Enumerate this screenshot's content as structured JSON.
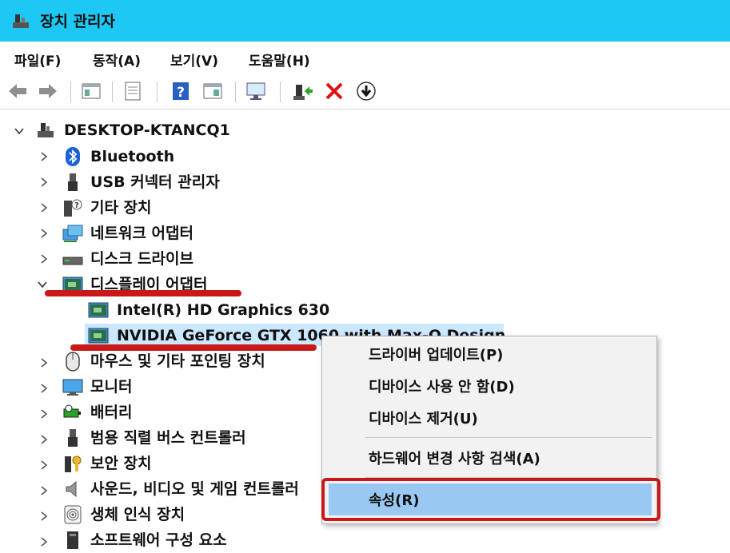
{
  "window": {
    "title": "장치 관리자"
  },
  "menu": [
    "파일(F)",
    "동작(A)",
    "보기(V)",
    "도움말(H)"
  ],
  "tree": {
    "root": "DESKTOP-KTANCQ1",
    "items": [
      {
        "label": "Bluetooth",
        "icon": "bluetooth-icon"
      },
      {
        "label": "USB 커넥터 관리자",
        "icon": "usb-icon"
      },
      {
        "label": "기타 장치",
        "icon": "unknown-device-icon"
      },
      {
        "label": "네트워크 어댑터",
        "icon": "network-icon"
      },
      {
        "label": "디스크 드라이브",
        "icon": "disk-icon"
      },
      {
        "label": "디스플레이 어댑터",
        "icon": "display-adapter-icon"
      },
      {
        "label": "Intel(R) HD Graphics 630",
        "icon": "display-adapter-icon"
      },
      {
        "label": "NVIDIA GeForce GTX 1060 with Max-Q Design",
        "icon": "display-adapter-icon"
      },
      {
        "label": "마우스 및 기타 포인팅 장치",
        "icon": "mouse-icon"
      },
      {
        "label": "모니터",
        "icon": "monitor-icon"
      },
      {
        "label": "배터리",
        "icon": "battery-icon"
      },
      {
        "label": "범용 직렬 버스 컨트롤러",
        "icon": "usb-icon"
      },
      {
        "label": "보안 장치",
        "icon": "security-icon"
      },
      {
        "label": "사운드, 비디오 및 게임 컨트롤러",
        "icon": "speaker-icon"
      },
      {
        "label": "생체 인식 장치",
        "icon": "fingerprint-icon"
      },
      {
        "label": "소프트웨어 구성 요소",
        "icon": "software-icon"
      }
    ]
  },
  "context_menu": {
    "items": [
      "드라이버 업데이트(P)",
      "디바이스 사용 안 함(D)",
      "디바이스 제거(U)",
      "하드웨어 변경 사항 검색(A)",
      "속성(R)"
    ]
  },
  "colors": {
    "titlebar": "#1ec8f5",
    "selection": "#cce8ff",
    "highlight": "#99c9f2",
    "annotation_red": "#c81818"
  }
}
